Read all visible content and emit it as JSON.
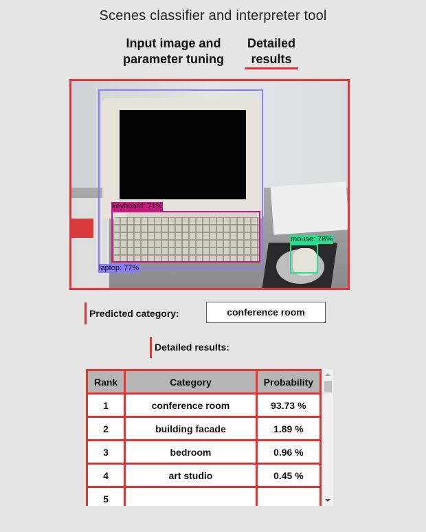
{
  "app": {
    "title": "Scenes classifier and interpreter tool"
  },
  "tabs": [
    {
      "label": "Input image and parameter tuning",
      "active": false
    },
    {
      "label": "Detailed results",
      "active": true
    }
  ],
  "accent_color": "#e53333",
  "image": {
    "detections": [
      {
        "label": "laptop: 77%",
        "color": "#8c7cf5"
      },
      {
        "label": "keyboard: 71%",
        "color": "#c6187f"
      },
      {
        "label": "mouse: 78%",
        "color": "#22e08f"
      }
    ]
  },
  "prediction": {
    "label": "Predicted category:",
    "value": "conference room"
  },
  "details": {
    "label": "Detailed results:",
    "columns": [
      "Rank",
      "Category",
      "Probability"
    ],
    "rows": [
      {
        "rank": "1",
        "category": "conference room",
        "probability": "93.73 %"
      },
      {
        "rank": "2",
        "category": "building facade",
        "probability": "1.89 %"
      },
      {
        "rank": "3",
        "category": "bedroom",
        "probability": "0.96 %"
      },
      {
        "rank": "4",
        "category": "art studio",
        "probability": "0.45 %"
      },
      {
        "rank": "5",
        "category": "",
        "probability": ""
      }
    ]
  }
}
